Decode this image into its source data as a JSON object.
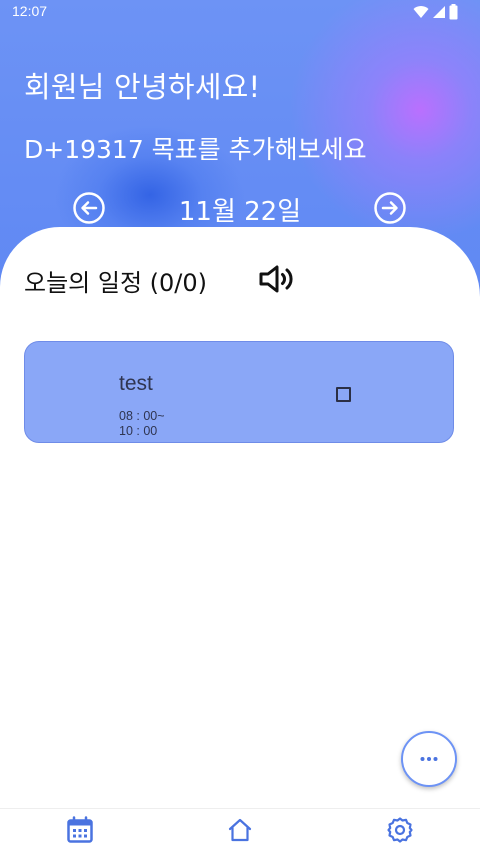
{
  "status_bar": {
    "time": "12:07",
    "icons": [
      "wifi-icon",
      "cellular-signal-icon",
      "battery-icon"
    ]
  },
  "header": {
    "greeting": "회원님 안녕하세요!",
    "dday_goal": "D+19317 목표를 추가해보세요",
    "date": "11월 22일",
    "prev_icon": "arrow-left-circle-icon",
    "next_icon": "arrow-right-circle-icon"
  },
  "schedule": {
    "title": "오늘의 일정 (0/0)",
    "speaker_icon": "speaker-volume-icon",
    "tasks": [
      {
        "title": "test",
        "start": "08 : 00~",
        "end": "10 : 00",
        "checked": false
      }
    ]
  },
  "fab": {
    "icon": "more-horizontal-icon"
  },
  "bottom_nav": {
    "items": [
      "calendar-icon",
      "home-icon",
      "settings-gear-icon"
    ]
  },
  "colors": {
    "primary": "#6d93f5",
    "card": "#8aa7f7",
    "nav_icon": "#4a73e0"
  }
}
